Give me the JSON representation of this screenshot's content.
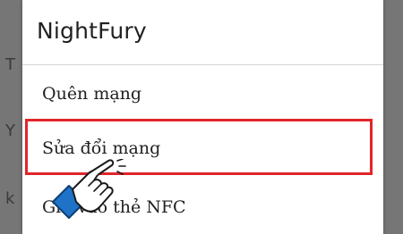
{
  "background": {
    "letters": [
      "T",
      "Y",
      "k"
    ]
  },
  "dialog": {
    "title": "NightFury",
    "items": [
      {
        "label": "Quên mạng"
      },
      {
        "label": "Sửa đổi mạng"
      },
      {
        "label": "Ghi vào thẻ NFC"
      }
    ]
  },
  "colors": {
    "highlight": "#e1252a",
    "overlay": "#6e6e6e",
    "dialog_bg": "#ffffff"
  },
  "icons": {
    "pointer": "hand-pointer-icon"
  }
}
